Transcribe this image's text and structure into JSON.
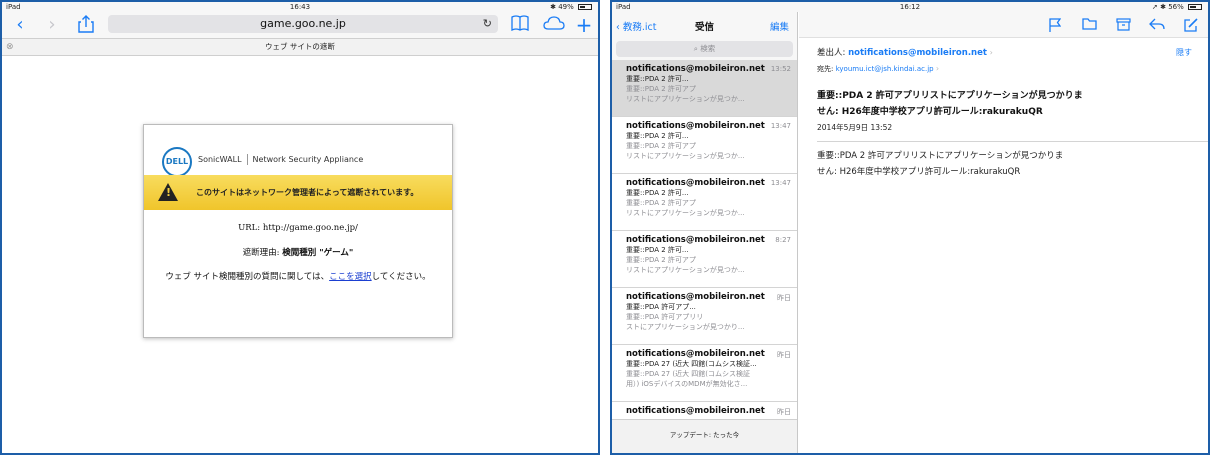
{
  "safari": {
    "status": {
      "device": "iPad",
      "time": "16:43",
      "battery": "49%",
      "battery_fraction": 0.49
    },
    "url": "game.goo.ne.jp",
    "tab_title": "ウェブ サイトの遮断",
    "brand": {
      "logo": "DELL",
      "product": "SonicWALL",
      "appliance": "Network Security Appliance"
    },
    "warning": "このサイトはネットワーク管理者によって遮断されています。",
    "url_line": "URL: http://game.goo.ne.jp/",
    "reason_label": "遮断理由: ",
    "reason_value": "検閲種別 \"ゲーム\"",
    "question_pre": "ウェブ サイト検閲種別の質問に関しては、",
    "question_link": "ここを選択",
    "question_post": "してください。"
  },
  "mail": {
    "status": {
      "device": "iPad",
      "time": "16:12",
      "battery": "56%",
      "battery_fraction": 0.56
    },
    "nav": {
      "back": "教務.ict",
      "title": "受信",
      "edit": "編集"
    },
    "search_placeholder": "検索",
    "items": [
      {
        "from": "notifications@mobileiron.net",
        "time": "13:52",
        "line1": "重要::PDA 2 許可...",
        "line2": "重要::PDA 2 許可アプ",
        "line3": "リストにアプリケーションが見つか..."
      },
      {
        "from": "notifications@mobileiron.net",
        "time": "13:47",
        "line1": "重要::PDA 2 許可...",
        "line2": "重要::PDA 2 許可アプ",
        "line3": "リストにアプリケーションが見つか..."
      },
      {
        "from": "notifications@mobileiron.net",
        "time": "13:47",
        "line1": "重要::PDA 2 許可...",
        "line2": "重要::PDA 2 許可アプ",
        "line3": "リストにアプリケーションが見つか..."
      },
      {
        "from": "notifications@mobileiron.net",
        "time": "8:27",
        "line1": "重要::PDA 2 許可...",
        "line2": "重要::PDA 2 許可アプ",
        "line3": "リストにアプリケーションが見つか..."
      },
      {
        "from": "notifications@mobileiron.net",
        "time": "昨日",
        "line1": "重要::PDA 許可アプ...",
        "line2": "重要::PDA 許可アプリリ",
        "line3": "ストにアプリケーションが見つかり..."
      },
      {
        "from": "notifications@mobileiron.net",
        "time": "昨日",
        "line1": "重要::PDA 27 (近大 四館(コムシス検証...",
        "line2": "重要::PDA 27 (近大 四館(コムシス検証",
        "line3": "用）) iOSデバイスのMDMが無効化さ..."
      },
      {
        "from": "notifications@mobileiron.net",
        "time": "昨日",
        "line1": "",
        "line2": "",
        "line3": ""
      }
    ],
    "update_text": "アップデート: たった今",
    "detail": {
      "from_label": "差出人: ",
      "from_addr": "notifications@mobileiron.net",
      "to_label": "宛先: ",
      "to_addr": "kyoumu.ict@jsh.kindai.ac.jp",
      "hide": "隠す",
      "subject_1": "重要::PDA 2  許可アプリリストにアプリケーションが見つかりま",
      "subject_2": "せん: H26年度中学校アプリ許可ルール:rakurakuQR",
      "date": "2014年5月9日 13:52",
      "body_1": "重要::PDA 2  許可アプリリストにアプリケーションが見つかりま",
      "body_2": "せん: H26年度中学校アプリ許可ルール:rakurakuQR"
    }
  }
}
